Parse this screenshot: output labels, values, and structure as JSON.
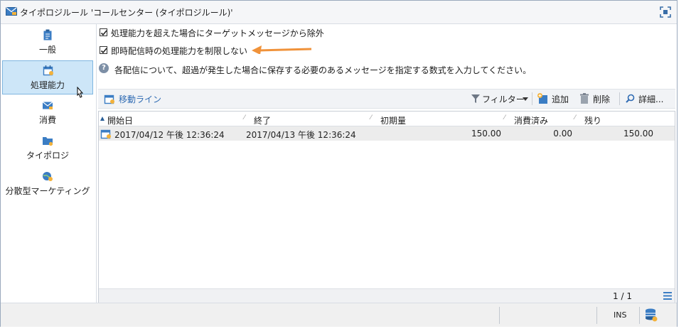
{
  "window": {
    "title": "タイポロジルール 'コールセンター (タイポロジルール)'"
  },
  "sidebar": {
    "items": [
      {
        "label": "一般",
        "icon": "clipboard-icon",
        "selected": false
      },
      {
        "label": "処理能力",
        "icon": "calendar-icon",
        "selected": true
      },
      {
        "label": "消費",
        "icon": "envelope-icon",
        "selected": false
      },
      {
        "label": "タイポロジ",
        "icon": "folder-icon",
        "selected": false
      },
      {
        "label": "分散型マーケティング",
        "icon": "globe-icon",
        "selected": false
      }
    ]
  },
  "options": {
    "exclude_label": "処理能力を超えた場合にターゲットメッセージから除外",
    "exclude_checked": true,
    "unlimited_label": "即時配信時の処理能力を制限しない",
    "unlimited_checked": true,
    "help_text": "各配信について、超過が発生した場合に保存する必要のあるメッセージを指定する数式を入力してください。"
  },
  "toolbar": {
    "move_line": "移動ライン",
    "filter": "フィルター",
    "add": "追加",
    "delete": "削除",
    "detail": "詳細..."
  },
  "table": {
    "columns": [
      "開始日",
      "終了",
      "初期量",
      "消費済み",
      "残り"
    ],
    "rows": [
      {
        "start": "2017/04/12 午後 12:36:24",
        "end": "2017/04/13 午後 12:36:24",
        "initial": "150.00",
        "consumed": "0.00",
        "remaining": "150.00"
      }
    ],
    "pagination": "1 / 1"
  },
  "statusbar": {
    "mode": "INS"
  },
  "colors": {
    "accent_arrow": "#f0923a",
    "selection": "#cde6f8",
    "link": "#2f6bb3"
  }
}
